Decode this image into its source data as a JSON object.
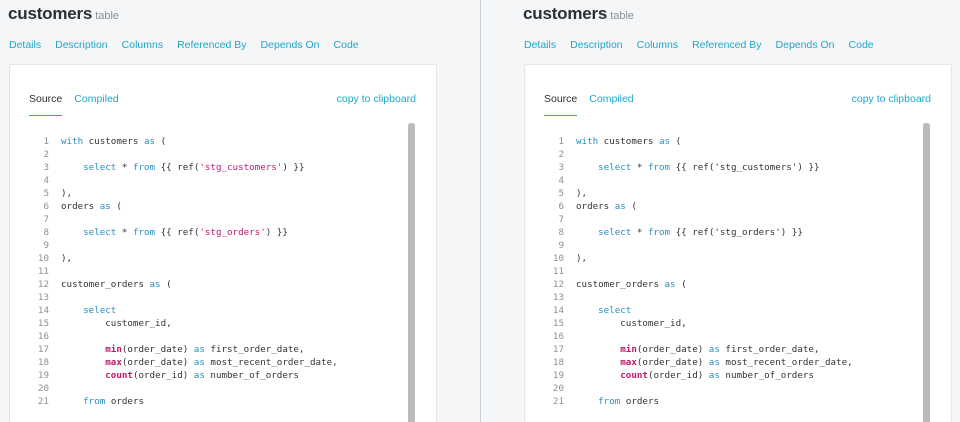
{
  "header": {
    "title": "customers",
    "subtitle": "table"
  },
  "nav": [
    "Details",
    "Description",
    "Columns",
    "Referenced By",
    "Depends On",
    "Code"
  ],
  "tabs": {
    "source": "Source",
    "compiled": "Compiled"
  },
  "copy_label": "copy to clipboard",
  "line_numbers": [
    "1",
    "2",
    "3",
    "4",
    "5",
    "6",
    "7",
    "8",
    "9",
    "10",
    "11",
    "12",
    "13",
    "14",
    "15",
    "16",
    "17",
    "18",
    "19",
    "20",
    "21"
  ],
  "code_left": {
    "l1": [
      "with",
      " customers ",
      "as",
      " ("
    ],
    "l3": [
      "select",
      " * ",
      "from",
      " {{ ref(",
      "'stg_customers'",
      ") }}"
    ],
    "l5": "),",
    "l6": [
      "orders ",
      "as",
      " ("
    ],
    "l8": [
      "select",
      " * ",
      "from",
      " {{ ref(",
      "'stg_orders'",
      ") }}"
    ],
    "l10": "),",
    "l12": [
      "customer_orders ",
      "as",
      " ("
    ],
    "l14": "select",
    "l15": "customer_id,",
    "l17": [
      "min",
      "(order_date) ",
      "as",
      " first_order_date,"
    ],
    "l18": [
      "max",
      "(order_date) ",
      "as",
      " most_recent_order_date,"
    ],
    "l19": [
      "count",
      "(order_id) ",
      "as",
      " number_of_orders"
    ],
    "l21": [
      "from",
      " orders"
    ]
  },
  "code_right": {
    "l1": [
      "with",
      " customers ",
      "as",
      " ("
    ],
    "l3": [
      "select",
      " * ",
      "from",
      " {{ ref(",
      "'stg_customers'",
      ") }}"
    ],
    "l5": "),",
    "l6": [
      "orders ",
      "as",
      " ("
    ],
    "l8": [
      "select",
      " * ",
      "from",
      " {{ ref(",
      "'stg_orders'",
      ") }}"
    ],
    "l10": "),",
    "l12": [
      "customer_orders ",
      "as",
      " ("
    ],
    "l14": "select",
    "l15": "customer_id,",
    "l17": [
      "min",
      "(order_date) ",
      "as",
      " first_order_date,"
    ],
    "l18": [
      "max",
      "(order_date) ",
      "as",
      " most_recent_order_date,"
    ],
    "l19": [
      "count",
      "(order_id) ",
      "as",
      " number_of_orders"
    ],
    "l21": [
      "from",
      " orders"
    ]
  },
  "colors": {
    "accent": "#21a6c8",
    "keyword": "#2a8fc3",
    "function": "#c0186a",
    "string": "#c0186a"
  }
}
